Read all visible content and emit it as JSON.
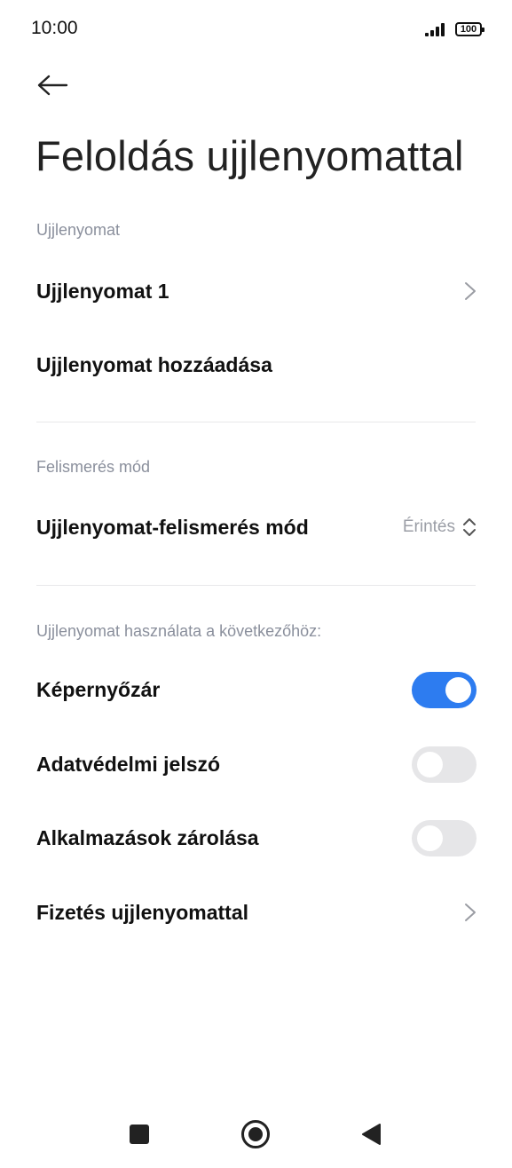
{
  "status_bar": {
    "time": "10:00",
    "battery": "100",
    "signal_icon": "signal-icon",
    "battery_icon": "battery-icon"
  },
  "header": {
    "back_icon": "arrow-left-icon",
    "title": "Feloldás ujjlenyomattal"
  },
  "sections": {
    "fingerprints": {
      "label": "Ujjlenyomat",
      "items": [
        {
          "label": "Ujjlenyomat 1",
          "icon": "chevron-right-icon"
        },
        {
          "label": "Ujjlenyomat hozzáadása"
        }
      ]
    },
    "recognition": {
      "label": "Felismerés mód",
      "mode_label": "Ujjlenyomat-felismerés mód",
      "mode_value": "Érintés",
      "mode_icon": "chevron-up-down-icon"
    },
    "usage": {
      "label": "Ujjlenyomat használata a következőhöz:",
      "items": [
        {
          "label": "Képernyőzár",
          "toggle_on": true
        },
        {
          "label": "Adatvédelmi jelszó",
          "toggle_on": false
        },
        {
          "label": "Alkalmazások zárolása",
          "toggle_on": false
        },
        {
          "label": "Fizetés ujjlenyomattal",
          "icon": "chevron-right-icon"
        }
      ]
    }
  },
  "colors": {
    "accent": "#2d7cf0",
    "toggle_off": "#e6e6e8",
    "section_label": "#8a8f9c"
  },
  "nav_bar": {
    "recents_icon": "square-icon",
    "home_icon": "home-circle-icon",
    "back_icon": "triangle-back-icon"
  }
}
